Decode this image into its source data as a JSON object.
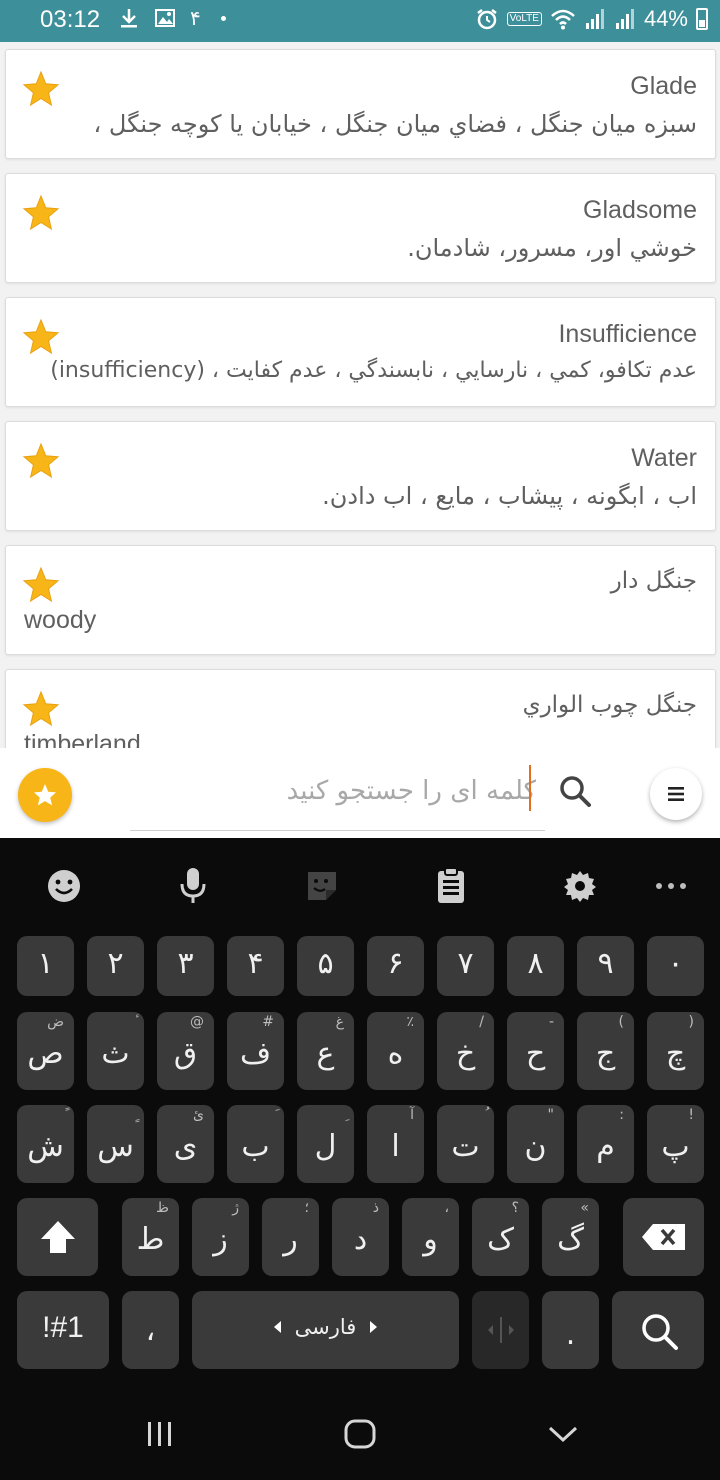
{
  "status_bar": {
    "time": "03:12",
    "notification_count": "۴",
    "volte_label": "VoLTE",
    "battery": "44%",
    "colors": {
      "background": "#3d8f99"
    }
  },
  "results": [
    {
      "word": "Glade",
      "meaning": "سبزه ميان جنگل ، فضاي ميان جنگل ، خيابان يا كوچه جنگل ،",
      "favorite": true
    },
    {
      "word": "Gladsome",
      "meaning": "خوشي اور، مسرور، شادمان.",
      "favorite": true
    },
    {
      "word": "Insufficience",
      "meaning": "عدم تكافو، كمي ، نارسايي ، نابسندگي ، عدم كفايت ، (insufficiency)",
      "favorite": true
    },
    {
      "word": "Water",
      "meaning": "اب ، ابگونه ، پيشاب ، مايع ، اب دادن.",
      "favorite": true
    },
    {
      "word": "جنگل دار",
      "meaning": "woody",
      "favorite": true
    },
    {
      "word": "جنگل چوب الواري",
      "meaning": "timberland",
      "favorite": true
    }
  ],
  "search": {
    "placeholder": "کلمه ای را جستجو کنید",
    "value": ""
  },
  "keyboard": {
    "toolbar": [
      "emoji-icon",
      "microphone-icon",
      "sticker-icon",
      "clipboard-icon",
      "settings-icon",
      "more-icon"
    ],
    "row_numbers": [
      "۱",
      "۲",
      "۳",
      "۴",
      "۵",
      "۶",
      "۷",
      "۸",
      "۹",
      "۰"
    ],
    "row1": [
      {
        "main": "ص",
        "sub": "ض"
      },
      {
        "main": "ث",
        "sub": "ٔ"
      },
      {
        "main": "ق",
        "sub": "@"
      },
      {
        "main": "ف",
        "sub": "#"
      },
      {
        "main": "ع",
        "sub": "غ"
      },
      {
        "main": "ه",
        "sub": "٪"
      },
      {
        "main": "خ",
        "sub": "/"
      },
      {
        "main": "ح",
        "sub": "-"
      },
      {
        "main": "ج",
        "sub": "("
      },
      {
        "main": "چ",
        "sub": ")"
      }
    ],
    "row2": [
      {
        "main": "ش",
        "sub": "ً"
      },
      {
        "main": "س",
        "sub": "ٍ"
      },
      {
        "main": "ی",
        "sub": "ئ"
      },
      {
        "main": "ب",
        "sub": "َ"
      },
      {
        "main": "ل",
        "sub": "ِ"
      },
      {
        "main": "ا",
        "sub": "آ"
      },
      {
        "main": "ت",
        "sub": "ُ"
      },
      {
        "main": "ن",
        "sub": "\""
      },
      {
        "main": "م",
        "sub": ":"
      },
      {
        "main": "پ",
        "sub": "!"
      }
    ],
    "row3": [
      {
        "main": "ط",
        "sub": "ظ"
      },
      {
        "main": "ز",
        "sub": "ژ"
      },
      {
        "main": "ر",
        "sub": "؛"
      },
      {
        "main": "د",
        "sub": "ذ"
      },
      {
        "main": "و",
        "sub": "،"
      },
      {
        "main": "ک",
        "sub": "؟"
      },
      {
        "main": "گ",
        "sub": "«"
      }
    ],
    "symbols_label": "!#1",
    "comma": "،",
    "space_label": "فارسی",
    "period": "."
  },
  "navigation": [
    "recent-apps-icon",
    "home-icon",
    "back-icon"
  ],
  "colors": {
    "accent_star": "#f7b517",
    "caret": "#e07020",
    "keyboard_bg": "#0b0b0b",
    "key_bg": "#3a3a3a"
  }
}
